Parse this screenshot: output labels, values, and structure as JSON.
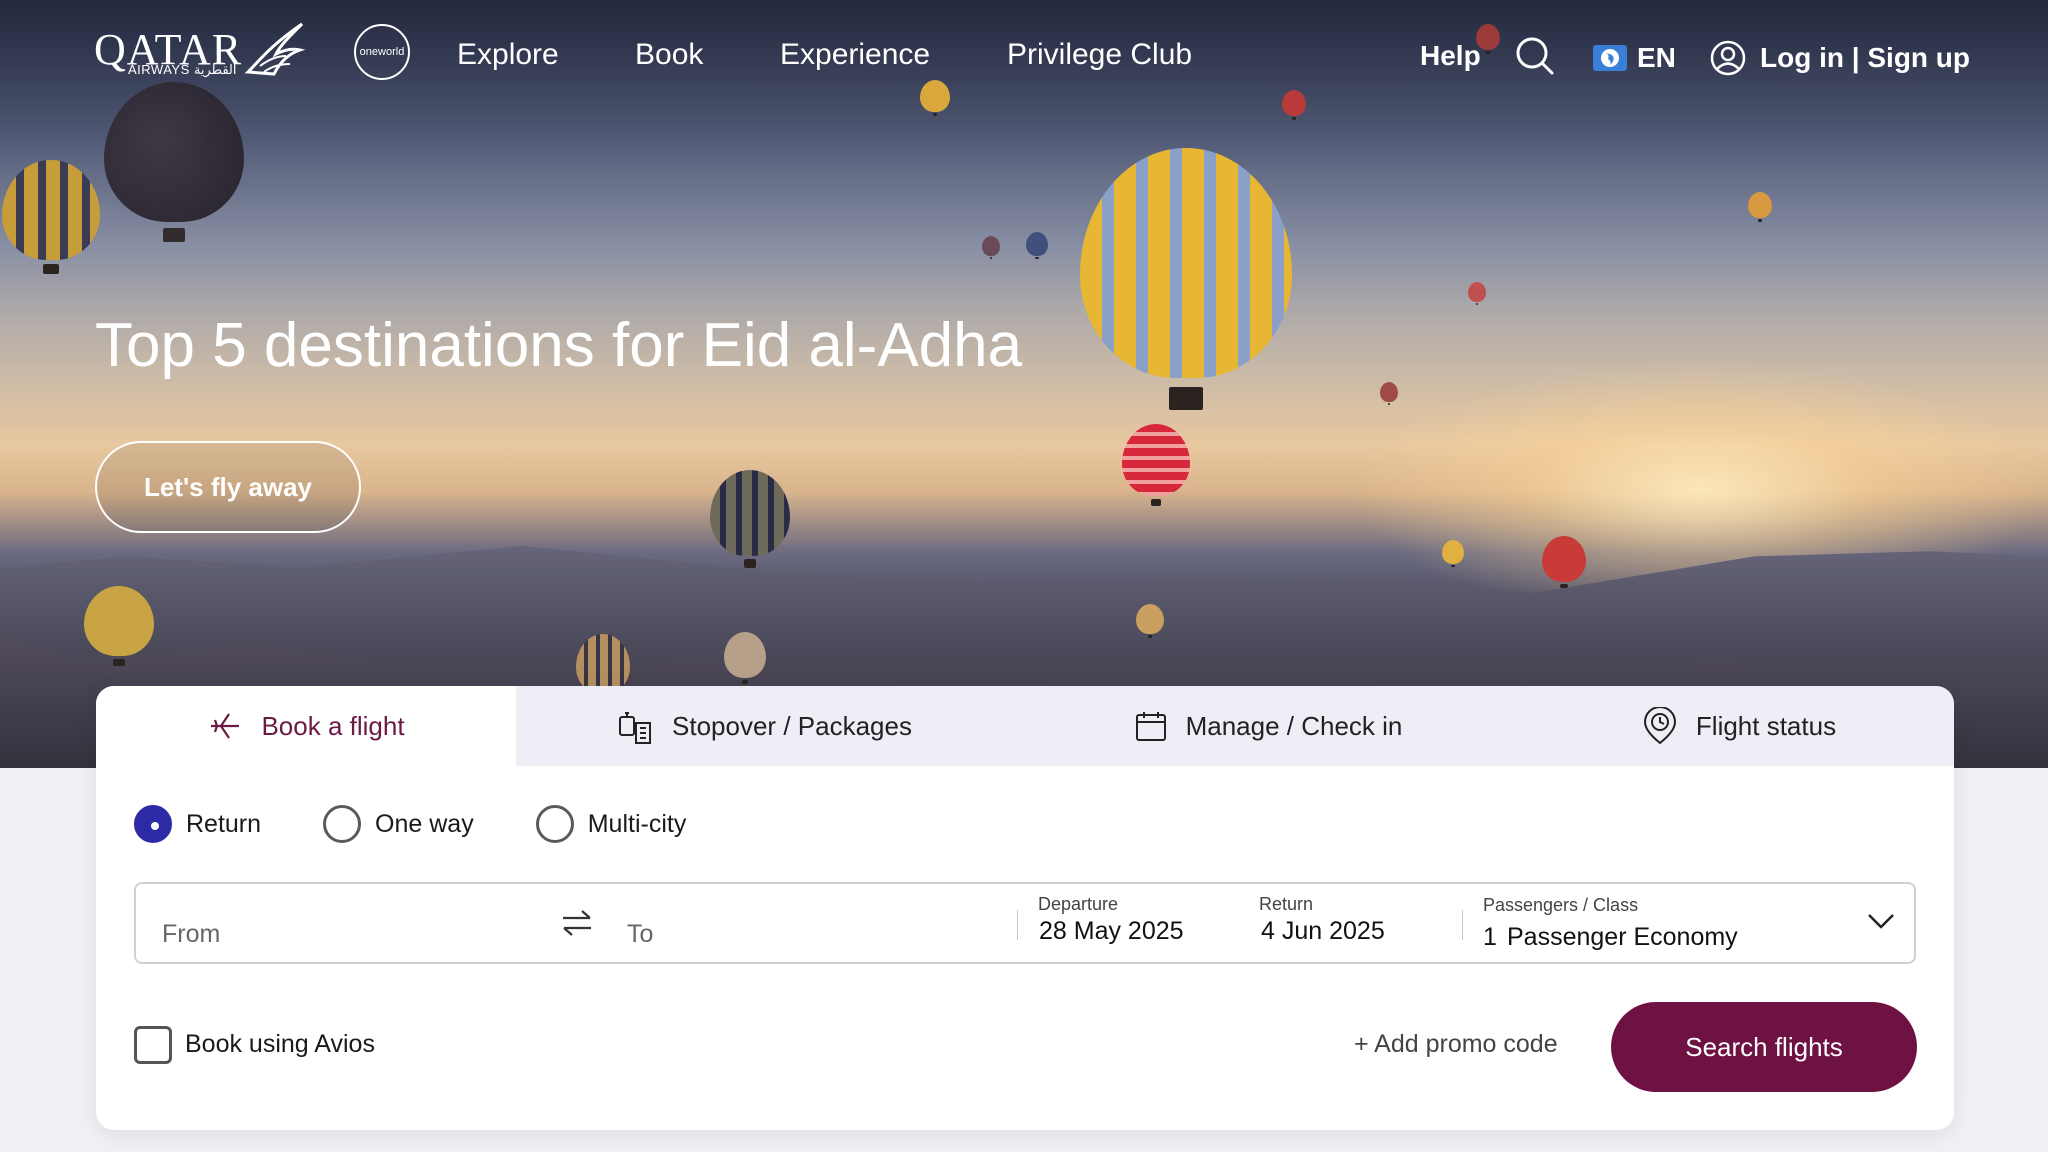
{
  "brand": {
    "logo_text": "QATAR",
    "logo_sub": "AIRWAYS القطرية",
    "alliance": "oneworld"
  },
  "nav": {
    "links": [
      "Explore",
      "Book",
      "Experience",
      "Privilege Club"
    ],
    "help": "Help",
    "language": "EN",
    "login": "Log in | Sign up"
  },
  "hero": {
    "title": "Top 5 destinations for Eid al-Adha",
    "cta": "Let's fly away"
  },
  "booking": {
    "tabs": [
      {
        "label": "Book a flight",
        "icon": "plane-icon",
        "active": true
      },
      {
        "label": "Stopover / Packages",
        "icon": "luggage-hotel-icon",
        "active": false
      },
      {
        "label": "Manage / Check in",
        "icon": "calendar-icon",
        "active": false
      },
      {
        "label": "Flight status",
        "icon": "location-clock-icon",
        "active": false
      }
    ],
    "trip_types": [
      {
        "label": "Return",
        "selected": true
      },
      {
        "label": "One way",
        "selected": false
      },
      {
        "label": "Multi-city",
        "selected": false
      }
    ],
    "from_placeholder": "From",
    "to_placeholder": "To",
    "departure_label": "Departure",
    "departure_value": "28 May 2025",
    "return_label": "Return",
    "return_value": "4 Jun 2025",
    "passengers_label": "Passengers / Class",
    "passengers_count": "1",
    "passengers_class": "Passenger Economy",
    "avios_label": "Book using Avios",
    "promo_label": "+ Add promo code",
    "search_label": "Search flights"
  },
  "colors": {
    "brand": "#6e1243",
    "radio_selected": "#2d2aa6",
    "tab_bg": "#eeeff6"
  }
}
